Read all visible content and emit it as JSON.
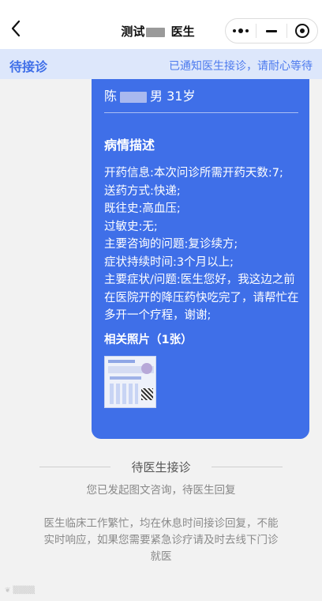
{
  "navbar": {
    "title_prefix": "测试",
    "title_suffix": " 医生"
  },
  "status": {
    "label": "待接诊",
    "message": "已通知医生接诊，请耐心等待"
  },
  "card": {
    "patient_surname": "陈",
    "patient_gender_age": "男 31岁",
    "section_heading": "病情描述",
    "info_lines": [
      "开药信息:本次问诊所需开药天数:7;",
      "送药方式:快递;",
      "既往史:高血压;",
      "过敏史:无;",
      "主要咨询的问题:复诊续方;",
      "症状持续时间:3个月以上;",
      "主要症状/问题:医生您好，我这边之前在医院开的降压药快吃完了，请帮忙在多开一个疗程，谢谢;"
    ],
    "photos_heading": "相关照片（1张）"
  },
  "notice": {
    "wait_label": "待医生接诊",
    "consult_text": "您已发起图文咨询，待医生回复",
    "busy_text": "医生临床工作繁忙，均在休息时间接诊回复，不能实时响应，如果您需要紧急诊疗请及时去线下门诊就医"
  },
  "colors": {
    "accent": "#3f6fe8",
    "status_bg": "#dde7fb",
    "page_bg": "#f2f2f2"
  },
  "icons": {
    "back": "chevron-left-icon",
    "more": "more-dots-icon",
    "minimize": "minus-icon",
    "close": "target-close-icon"
  }
}
